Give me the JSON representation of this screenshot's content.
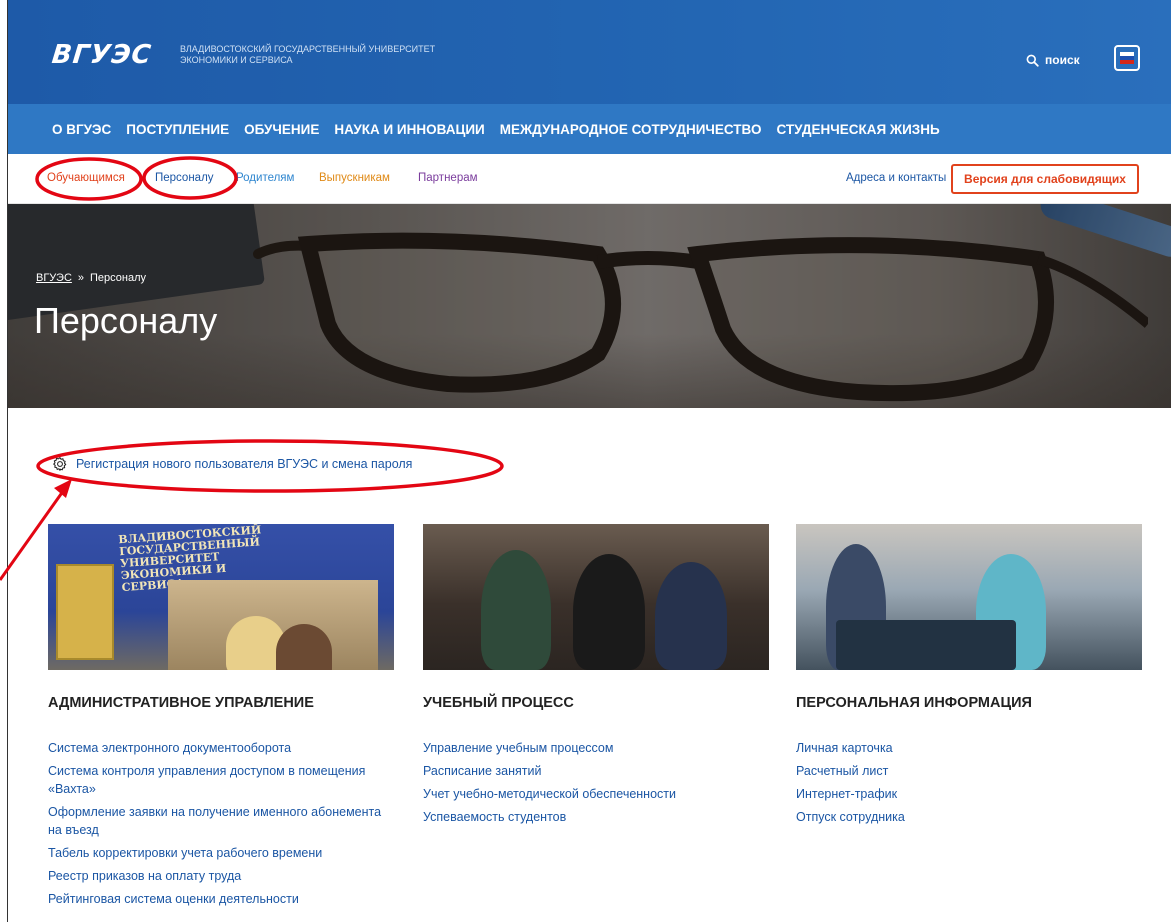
{
  "header": {
    "logo_text": "ВГУЭС",
    "tagline_line1": "ВЛАДИВОСТОКСКИЙ ГОСУДАРСТВЕННЫЙ УНИВЕРСИТЕТ",
    "tagline_line2": "ЭКОНОМИКИ И СЕРВИСА",
    "search_label": "поиск",
    "search_icon": "search-icon",
    "language_icon": "flag-ru-icon",
    "brand_color": "#2366b3"
  },
  "main_nav": {
    "items": [
      {
        "label": "О ВГУЭС"
      },
      {
        "label": "ПОСТУПЛЕНИЕ"
      },
      {
        "label": "ОБУЧЕНИЕ"
      },
      {
        "label": "НАУКА И ИННОВАЦИИ"
      },
      {
        "label": "МЕЖДУНАРОДНОЕ СОТРУДНИЧЕСТВО"
      },
      {
        "label": "СТУДЕНЧЕСКАЯ ЖИЗНЬ"
      }
    ]
  },
  "sub_nav": {
    "audiences": [
      {
        "label": "Обучающимся",
        "color": "#e1421c"
      },
      {
        "label": "Персоналу",
        "color": "#1b56a4"
      },
      {
        "label": "Родителям",
        "color": "#2f86cf"
      },
      {
        "label": "Выпускникам",
        "color": "#e08a17"
      },
      {
        "label": "Партнерам",
        "color": "#7b3d9d"
      }
    ],
    "contacts_label": "Адреса и контакты",
    "accessibility_label": "Версия для слабовидящих"
  },
  "hero": {
    "breadcrumb_home": "ВГУЭС",
    "breadcrumb_separator": "»",
    "breadcrumb_current": "Персоналу",
    "title": "Персоналу"
  },
  "registration": {
    "icon": "gear-icon",
    "label": "Регистрация нового пользователя ВГУЭС и смена пароля"
  },
  "sections": [
    {
      "title": "АДМИНИСТРАТИВНОЕ УПРАВЛЕНИЕ",
      "photo_text": "ВЛАДИВОСТОКСКИЙ ГОСУДАРСТВЕННЫЙ УНИВЕРСИТЕТ ЭКОНОМИКИ И СЕРВИСА",
      "links": [
        "Система электронного документооборота",
        "Система контроля управления доступом в помещения «Вахта»",
        "Оформление заявки на получение именного абонемента на въезд",
        "Табель корректировки учета рабочего времени",
        "Реестр приказов на оплату труда",
        "Рейтинговая система оценки деятельности"
      ]
    },
    {
      "title": "УЧЕБНЫЙ ПРОЦЕСС",
      "links": [
        "Управление учебным процессом",
        "Расписание занятий",
        "Учет учебно-методической обеспеченности",
        "Успеваемость студентов"
      ]
    },
    {
      "title": "ПЕРСОНАЛЬНАЯ ИНФОРМАЦИЯ",
      "links": [
        "Личная карточка",
        "Расчетный лист",
        "Интернет-трафик",
        "Отпуск сотрудника"
      ]
    }
  ],
  "annotation_color": "#e30613"
}
